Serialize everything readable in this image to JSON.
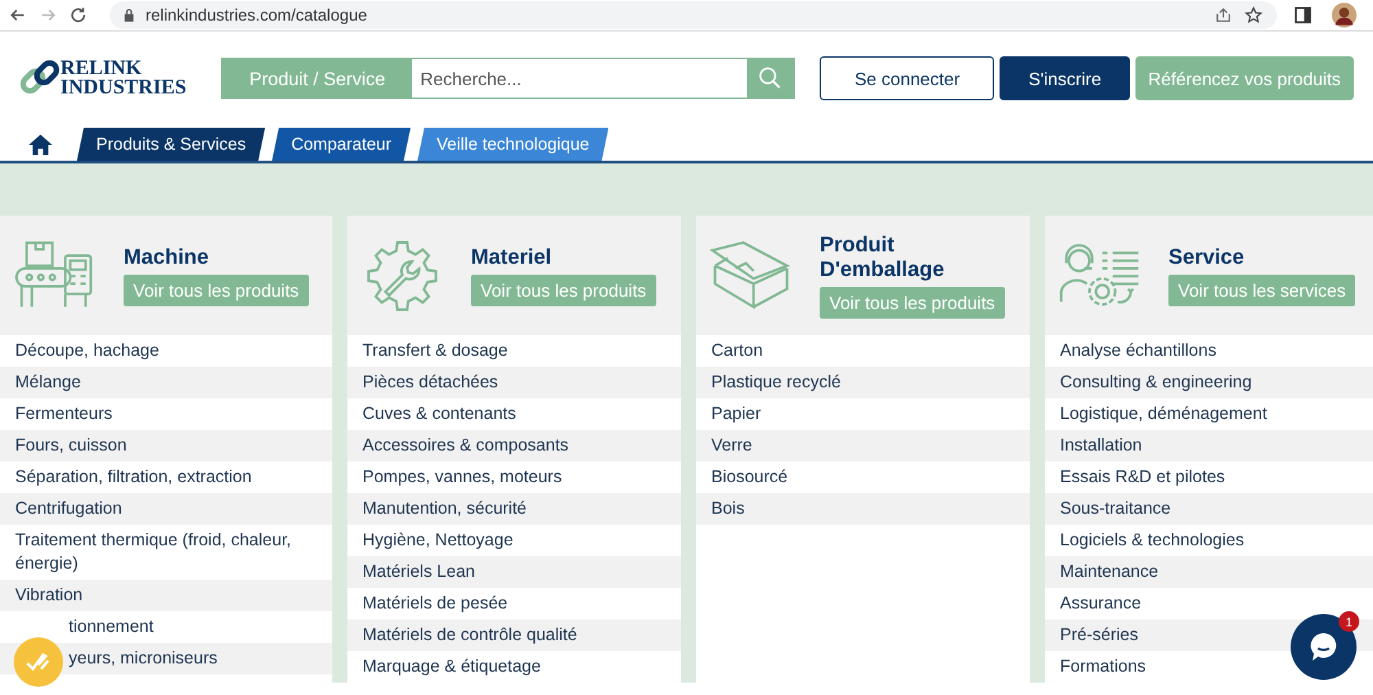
{
  "browser": {
    "url": "relinkindustries.com/catalogue",
    "forward_disabled": true
  },
  "header": {
    "logo": [
      "RELINK",
      "INDUSTRIES"
    ],
    "search_category": "Produit / Service",
    "search": {
      "placeholder": "Recherche..."
    },
    "login": "Se connecter",
    "signup": "S'inscrire",
    "reference": "Référencez vos produits"
  },
  "tabs": [
    {
      "label": "Produits & Services",
      "color": "#0a3566"
    },
    {
      "label": "Comparateur",
      "color": "#1257a5"
    },
    {
      "label": "Veille technologique",
      "color": "#3b86d6"
    }
  ],
  "categories": [
    {
      "kind": "machine",
      "title": "Machine",
      "button": "Voir tous les produits",
      "items": [
        "Découpe, hachage",
        "Mélange",
        "Fermenteurs",
        "Fours, cuisson",
        "Séparation, filtration, extraction",
        "Centrifugation",
        "Traitement thermique (froid, chaleur, énergie)",
        "Vibration",
        "tionnement",
        "yeurs, microniseurs"
      ]
    },
    {
      "kind": "tool",
      "title": "Materiel",
      "button": "Voir tous les produits",
      "items": [
        "Transfert & dosage",
        "Pièces détachées",
        "Cuves & contenants",
        "Accessoires & composants",
        "Pompes, vannes, moteurs",
        "Manutention, sécurité",
        "Hygiène, Nettoyage",
        "Matériels Lean",
        "Matériels de pesée",
        "Matériels de contrôle qualité",
        "Marquage & étiquetage"
      ]
    },
    {
      "kind": "box",
      "title": "Produit D'emballage",
      "button": "Voir tous les produits",
      "items": [
        "Carton",
        "Plastique recyclé",
        "Papier",
        "Verre",
        "Biosourcé",
        "Bois"
      ]
    },
    {
      "kind": "support",
      "title": "Service",
      "button": "Voir tous les services",
      "items": [
        "Analyse échantillons",
        "Consulting & engineering",
        "Logistique, déménagement",
        "Installation",
        "Essais R&D et pilotes",
        "Sous-traitance",
        "Logiciels & technologies",
        "Maintenance",
        "Assurance",
        "Pré-séries",
        "Formations"
      ]
    }
  ],
  "chat": {
    "badge": "1"
  }
}
